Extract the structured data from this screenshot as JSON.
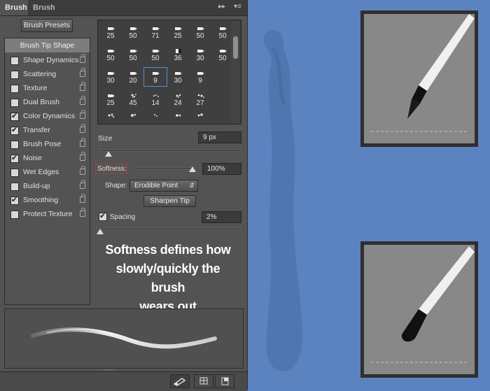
{
  "tabs": [
    {
      "label": "Brush",
      "active": true
    },
    {
      "label": "Brush Presets",
      "active": false
    }
  ],
  "panel_menu_icon": "panel-menu-icon",
  "brush_presets_button": "Brush Presets",
  "sidebar": {
    "header": "Brush Tip Shape",
    "items": [
      {
        "label": "Shape Dynamics",
        "checked": false
      },
      {
        "label": "Scattering",
        "checked": false
      },
      {
        "label": "Texture",
        "checked": false
      },
      {
        "label": "Dual Brush",
        "checked": false
      },
      {
        "label": "Color Dynamics",
        "checked": true
      },
      {
        "label": "Transfer",
        "checked": true
      },
      {
        "label": "Brush Pose",
        "checked": false
      },
      {
        "label": "Noise",
        "checked": true
      },
      {
        "label": "Wet Edges",
        "checked": false
      },
      {
        "label": "Build-up",
        "checked": false
      },
      {
        "label": "Smoothing",
        "checked": true
      },
      {
        "label": "Protect Texture",
        "checked": false
      }
    ]
  },
  "brush_grid": [
    [
      "25",
      "50",
      "71",
      "25",
      "50",
      "50"
    ],
    [
      "50",
      "50",
      "50",
      "36",
      "30",
      "50"
    ],
    [
      "30",
      "20",
      "9",
      "30",
      "9",
      ""
    ],
    [
      "25",
      "45",
      "14",
      "24",
      "27",
      ""
    ]
  ],
  "selected_brush": "9",
  "size": {
    "label": "Size",
    "value": "9 px"
  },
  "softness": {
    "label": "Softness:",
    "value": "100%"
  },
  "shape": {
    "label": "Shape:",
    "value": "Erodible Point"
  },
  "sharpen_tip_button": "Sharpen Tip",
  "spacing": {
    "label": "Spacing",
    "value": "2%",
    "checked": true
  },
  "caption": [
    "Softness defines how",
    "slowly/quickly the brush",
    "wears out"
  ],
  "colors": {
    "canvas": "#5b83bf",
    "panel": "#535353",
    "selection": "#4a8fdb"
  }
}
